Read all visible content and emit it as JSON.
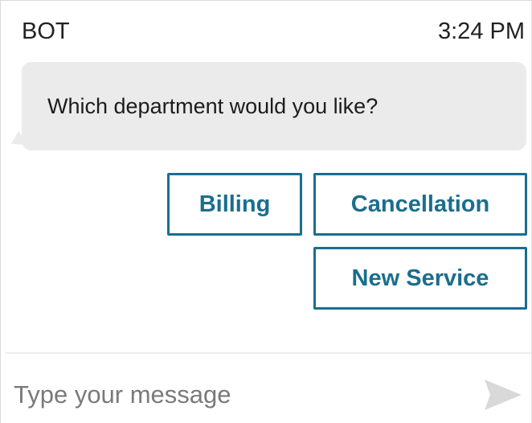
{
  "header": {
    "sender": "BOT",
    "time": "3:24 PM"
  },
  "message": {
    "text": "Which department would you like?"
  },
  "quick_replies": [
    {
      "label": "Billing"
    },
    {
      "label": "Cancellation"
    },
    {
      "label": "New Service"
    }
  ],
  "composer": {
    "placeholder": "Type your message",
    "value": "",
    "send_icon": "send-icon"
  },
  "colors": {
    "accent": "#1a6e8e",
    "bubble_bg": "#ebebeb",
    "send_icon": "#d9d9d9"
  }
}
